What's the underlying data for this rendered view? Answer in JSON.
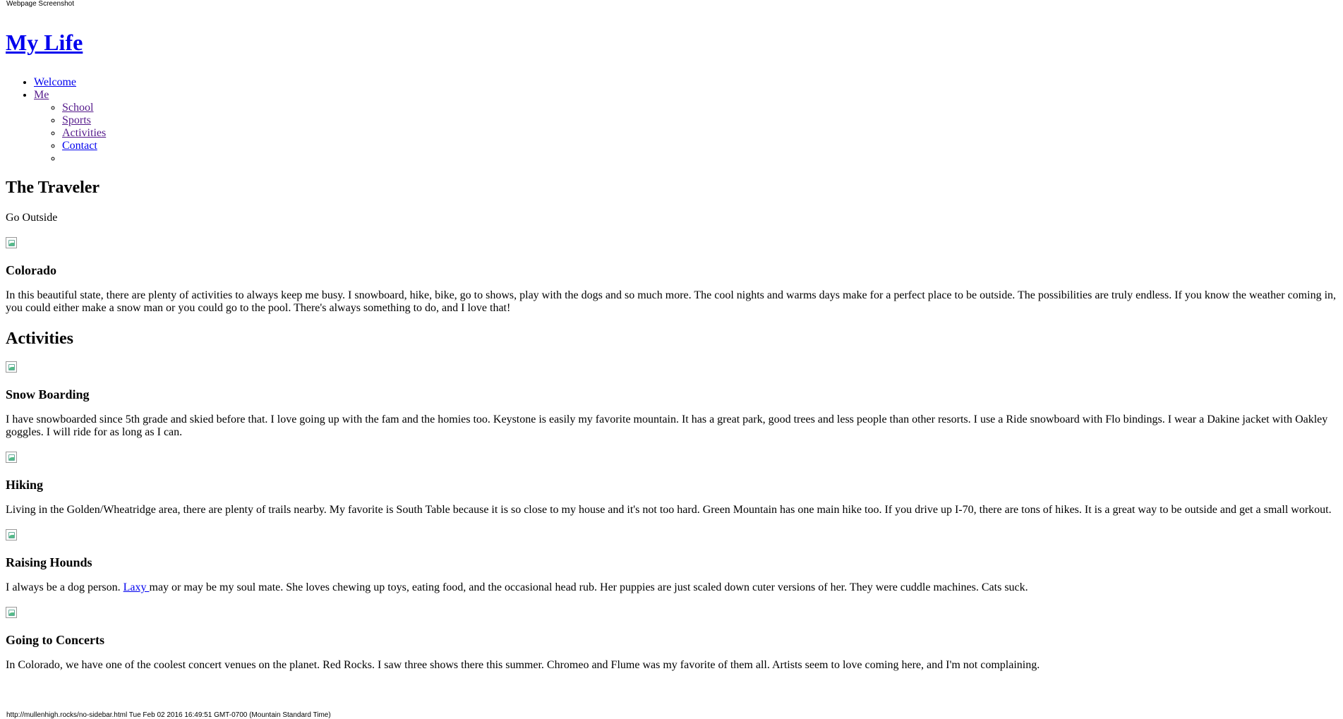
{
  "screenshot": {
    "header_label": "Webpage Screenshot",
    "footer_label": "http://mullenhigh.rocks/no-sidebar.html Tue Feb 02 2016 16:49:51 GMT-0700 (Mountain Standard Time)"
  },
  "site": {
    "title": "My Life"
  },
  "nav": {
    "items": [
      {
        "label": "Welcome"
      },
      {
        "label": "Me"
      }
    ],
    "sub_items": [
      {
        "label": "School"
      },
      {
        "label": "Sports"
      },
      {
        "label": "Activities"
      },
      {
        "label": "Contact"
      }
    ]
  },
  "hero": {
    "title": "The Traveler",
    "subtitle": "Go Outside"
  },
  "colorado": {
    "heading": "Colorado",
    "body": "In this beautiful state, there are plenty of activities to always keep me busy. I snowboard, hike, bike, go to shows, play with the dogs and so much more. The cool nights and warms days make for a perfect place to be outside. The possibilities are truly endless. If you know the weather coming in, you could either make a snow man or you could go to the pool. There's always something to do, and I love that!"
  },
  "activities": {
    "heading": "Activities",
    "items": [
      {
        "title": "Snow Boarding",
        "body": "I have snowboarded since 5th grade and skied before that. I love going up with the fam and the homies too. Keystone is easily my favorite mountain. It has a great park, good trees and less people than other resorts. I use a Ride snowboard with Flo bindings. I wear a Dakine jacket with Oakley goggles. I will ride for as long as I can."
      },
      {
        "title": "Hiking",
        "body": "Living in the Golden/Wheatridge area, there are plenty of trails nearby. My favorite is South Table because it is so close to my house and it's not too hard. Green Mountain has one main hike too. If you drive up I-70, there are tons of hikes. It is a great way to be outside and get a small workout."
      },
      {
        "title": "Raising Hounds",
        "body_before": "I always be a dog person. ",
        "link": "Laxy ",
        "body_after": "may or may be my soul mate. She loves chewing up toys, eating food, and the occasional head rub. Her puppies are just scaled down cuter versions of her. They were cuddle machines. Cats suck."
      },
      {
        "title": "Going to Concerts",
        "body": "In Colorado, we have one of the coolest concert venues on the planet. Red Rocks. I saw three shows there this summer. Chromeo and Flume was my favorite of them all. Artists seem to love coming here, and I'm not complaining."
      }
    ]
  }
}
